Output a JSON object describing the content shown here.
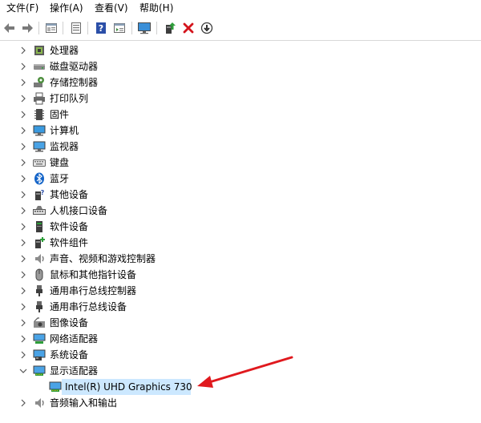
{
  "menu": {
    "file": "文件(F)",
    "action": "操作(A)",
    "view": "查看(V)",
    "help": "帮助(H)"
  },
  "toolbar": {
    "icons": [
      "back-icon",
      "forward-icon",
      "properties-icon",
      "list-icon",
      "help-icon",
      "details-icon",
      "monitor-icon",
      "update-driver-icon",
      "uninstall-icon",
      "download-icon"
    ]
  },
  "tree": {
    "items": [
      {
        "label": "处理器",
        "icon": "processor-icon"
      },
      {
        "label": "磁盘驱动器",
        "icon": "disk-drive-icon"
      },
      {
        "label": "存储控制器",
        "icon": "storage-controller-icon"
      },
      {
        "label": "打印队列",
        "icon": "printer-icon"
      },
      {
        "label": "固件",
        "icon": "firmware-icon"
      },
      {
        "label": "计算机",
        "icon": "computer-icon"
      },
      {
        "label": "监视器",
        "icon": "monitor-icon"
      },
      {
        "label": "键盘",
        "icon": "keyboard-icon"
      },
      {
        "label": "蓝牙",
        "icon": "bluetooth-icon"
      },
      {
        "label": "其他设备",
        "icon": "other-devices-icon"
      },
      {
        "label": "人机接口设备",
        "icon": "hid-icon"
      },
      {
        "label": "软件设备",
        "icon": "software-device-icon"
      },
      {
        "label": "软件组件",
        "icon": "software-component-icon"
      },
      {
        "label": "声音、视频和游戏控制器",
        "icon": "audio-icon"
      },
      {
        "label": "鼠标和其他指针设备",
        "icon": "mouse-icon"
      },
      {
        "label": "通用串行总线控制器",
        "icon": "usb-icon"
      },
      {
        "label": "通用串行总线设备",
        "icon": "usb-icon"
      },
      {
        "label": "图像设备",
        "icon": "camera-icon"
      },
      {
        "label": "网络适配器",
        "icon": "network-adapter-icon"
      },
      {
        "label": "系统设备",
        "icon": "system-device-icon"
      },
      {
        "label": "显示适配器",
        "icon": "display-adapter-icon",
        "expanded": true
      },
      {
        "label": "Intel(R) UHD Graphics 730",
        "icon": "graphics-card-icon",
        "child": true,
        "selected": true
      },
      {
        "label": "音频输入和输出",
        "icon": "audio-io-icon"
      }
    ]
  },
  "colors": {
    "selection": "#cce8ff",
    "arrow": "#e0191e"
  }
}
